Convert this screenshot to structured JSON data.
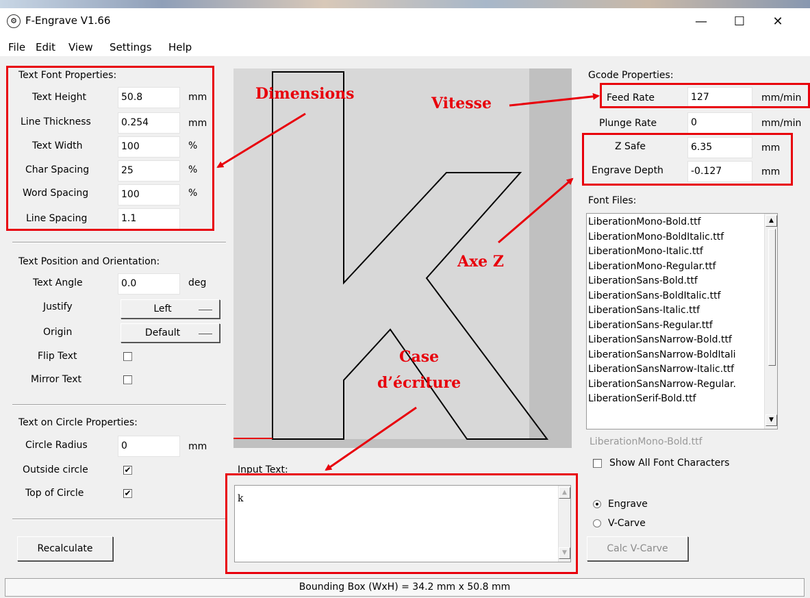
{
  "window": {
    "title": "F-Engrave V1.66",
    "minimize": "—",
    "maximize": "☐",
    "close": "✕"
  },
  "menu": [
    "File",
    "Edit",
    "View",
    "Settings",
    "Help"
  ],
  "font_props": {
    "heading": "Text Font Properties:",
    "rows": [
      {
        "label": "Text Height",
        "value": "50.8",
        "unit": "mm"
      },
      {
        "label": "Line Thickness",
        "value": "0.254",
        "unit": "mm"
      },
      {
        "label": "Text Width",
        "value": "100",
        "unit": "%"
      },
      {
        "label": "Char Spacing",
        "value": "25",
        "unit": "%"
      },
      {
        "label": "Word Spacing",
        "value": "100",
        "unit": "%"
      },
      {
        "label": "Line Spacing",
        "value": "1.1",
        "unit": ""
      }
    ]
  },
  "position": {
    "heading": "Text Position and Orientation:",
    "angle_label": "Text Angle",
    "angle_value": "0.0",
    "angle_unit": "deg",
    "justify_label": "Justify",
    "justify_value": "Left",
    "origin_label": "Origin",
    "origin_value": "Default",
    "flip_label": "Flip Text",
    "flip_checked": false,
    "mirror_label": "Mirror Text",
    "mirror_checked": false
  },
  "circle": {
    "heading": "Text on Circle Properties:",
    "radius_label": "Circle Radius",
    "radius_value": "0",
    "radius_unit": "mm",
    "outside_label": "Outside circle",
    "outside_checked": true,
    "top_label": "Top of Circle",
    "top_checked": true,
    "check_mark": "✔"
  },
  "recalculate": "Recalculate",
  "input": {
    "label": "Input Text:",
    "value": "k"
  },
  "gcode": {
    "heading": "Gcode Properties:",
    "rows": [
      {
        "label": "Feed Rate",
        "value": "127",
        "unit": "mm/min"
      },
      {
        "label": "Plunge Rate",
        "value": "0",
        "unit": "mm/min"
      },
      {
        "label": "Z Safe",
        "value": "6.35",
        "unit": "mm"
      },
      {
        "label": "Engrave Depth",
        "value": "-0.127",
        "unit": "mm"
      }
    ]
  },
  "fonts": {
    "heading": "Font Files:",
    "items": [
      "LiberationMono-Bold.ttf",
      "LiberationMono-BoldItalic.ttf",
      "LiberationMono-Italic.ttf",
      "LiberationMono-Regular.ttf",
      "LiberationSans-Bold.ttf",
      "LiberationSans-BoldItalic.ttf",
      "LiberationSans-Italic.ttf",
      "LiberationSans-Regular.ttf",
      "LiberationSansNarrow-Bold.ttf",
      "LiberationSansNarrow-BoldItali",
      "LiberationSansNarrow-Italic.ttf",
      "LiberationSansNarrow-Regular.",
      "LiberationSerif-Bold.ttf"
    ],
    "selected": "LiberationMono-Bold.ttf",
    "show_all_label": "Show All Font Characters",
    "show_all_checked": false
  },
  "mode": {
    "engrave": "Engrave",
    "vcarve": "V-Carve",
    "selected": "Engrave",
    "calc_button": "Calc V-Carve"
  },
  "status": "Bounding Box (WxH) = 34.2 mm  x 50.8 mm",
  "annotations": {
    "dimensions": "Dimensions",
    "vitesse": "Vitesse",
    "axe_z": "Axe Z",
    "case_line1": "Case",
    "case_line2": "d’écriture"
  },
  "colors": {
    "annotation": "#e8000b",
    "canvas_bg": "#c0c0c0",
    "page_bg": "#d8d8d8"
  },
  "icons": {
    "up": "▲",
    "down": "▼"
  }
}
